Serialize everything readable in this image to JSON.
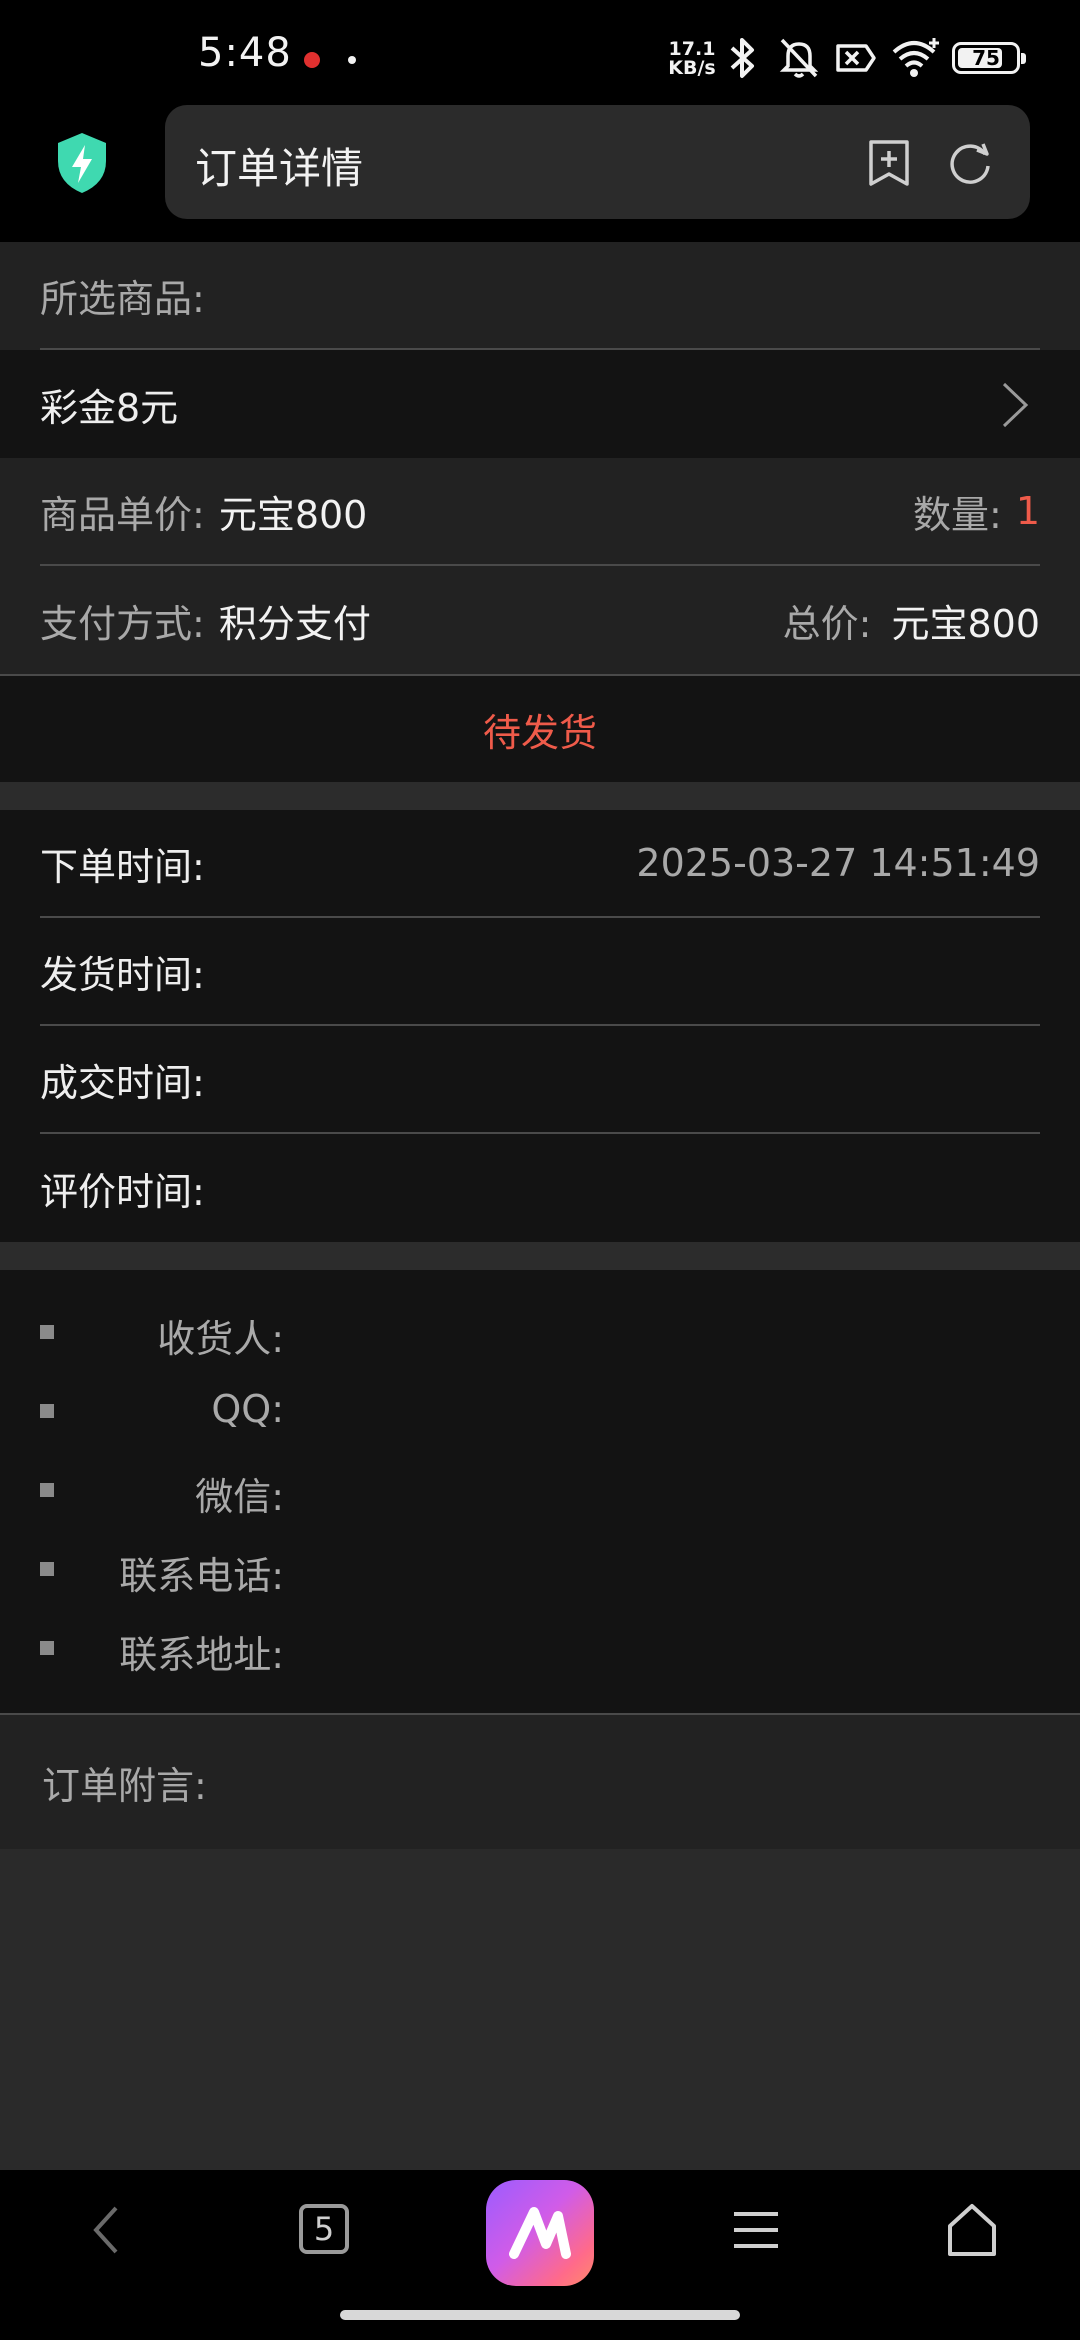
{
  "status_bar": {
    "time": "5:48",
    "net_speed_top": "17.1",
    "net_speed_bottom": "KB/s",
    "battery": "75"
  },
  "browser": {
    "page_title": "订单详情"
  },
  "product": {
    "selected_label": "所选商品:",
    "item_name": "彩金8元"
  },
  "pricing": {
    "unit_price_label": "商品单价:",
    "unit_price_value": "元宝800",
    "quantity_label": "数量:",
    "quantity_value": "1",
    "payment_label": "支付方式:",
    "payment_value": "积分支付",
    "total_label": "总价:",
    "total_value": "元宝800"
  },
  "order_status": "待发货",
  "times": {
    "order_time_label": "下单时间:",
    "order_time_value": "2025-03-27 14:51:49",
    "ship_time_label": "发货时间:",
    "deal_time_label": "成交时间:",
    "review_time_label": "评价时间:"
  },
  "contact": {
    "items": [
      {
        "label": "收货人:"
      },
      {
        "label": "QQ:"
      },
      {
        "label": "微信:"
      },
      {
        "label": "联系电话:"
      },
      {
        "label": "联系地址:"
      }
    ]
  },
  "note": {
    "label": "订单附言:"
  },
  "navbar": {
    "tab_count": "5"
  },
  "colors": {
    "accent": "#ef5b4a",
    "shield": "#3fd9b0"
  }
}
